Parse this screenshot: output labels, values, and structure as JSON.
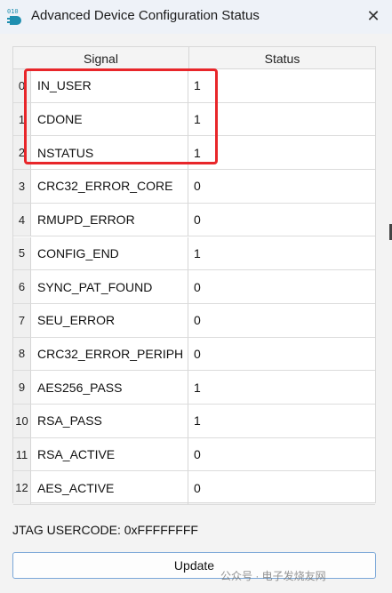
{
  "window": {
    "title": "Advanced Device Configuration Status",
    "close_glyph": "✕"
  },
  "table": {
    "headers": {
      "signal": "Signal",
      "status": "Status"
    },
    "rows": [
      {
        "index": "0",
        "signal": "IN_USER",
        "status": "1"
      },
      {
        "index": "1",
        "signal": "CDONE",
        "status": "1"
      },
      {
        "index": "2",
        "signal": "NSTATUS",
        "status": "1"
      },
      {
        "index": "3",
        "signal": "CRC32_ERROR_CORE",
        "status": "0"
      },
      {
        "index": "4",
        "signal": "RMUPD_ERROR",
        "status": "0"
      },
      {
        "index": "5",
        "signal": "CONFIG_END",
        "status": "1"
      },
      {
        "index": "6",
        "signal": "SYNC_PAT_FOUND",
        "status": "0"
      },
      {
        "index": "7",
        "signal": "SEU_ERROR",
        "status": "0"
      },
      {
        "index": "8",
        "signal": "CRC32_ERROR_PERIPH",
        "status": "0"
      },
      {
        "index": "9",
        "signal": "AES256_PASS",
        "status": "1"
      },
      {
        "index": "10",
        "signal": "RSA_PASS",
        "status": "1"
      },
      {
        "index": "11",
        "signal": "RSA_ACTIVE",
        "status": "0"
      },
      {
        "index": "12",
        "signal": "AES_ACTIVE",
        "status": "0"
      }
    ]
  },
  "usercode": "JTAG USERCODE: 0xFFFFFFFF",
  "buttons": {
    "update": "Update"
  },
  "watermark": {
    "text": "公众号 · 电子发烧友网"
  },
  "colors": {
    "highlight": "#e8262a",
    "button_border": "#7aa7d8"
  }
}
